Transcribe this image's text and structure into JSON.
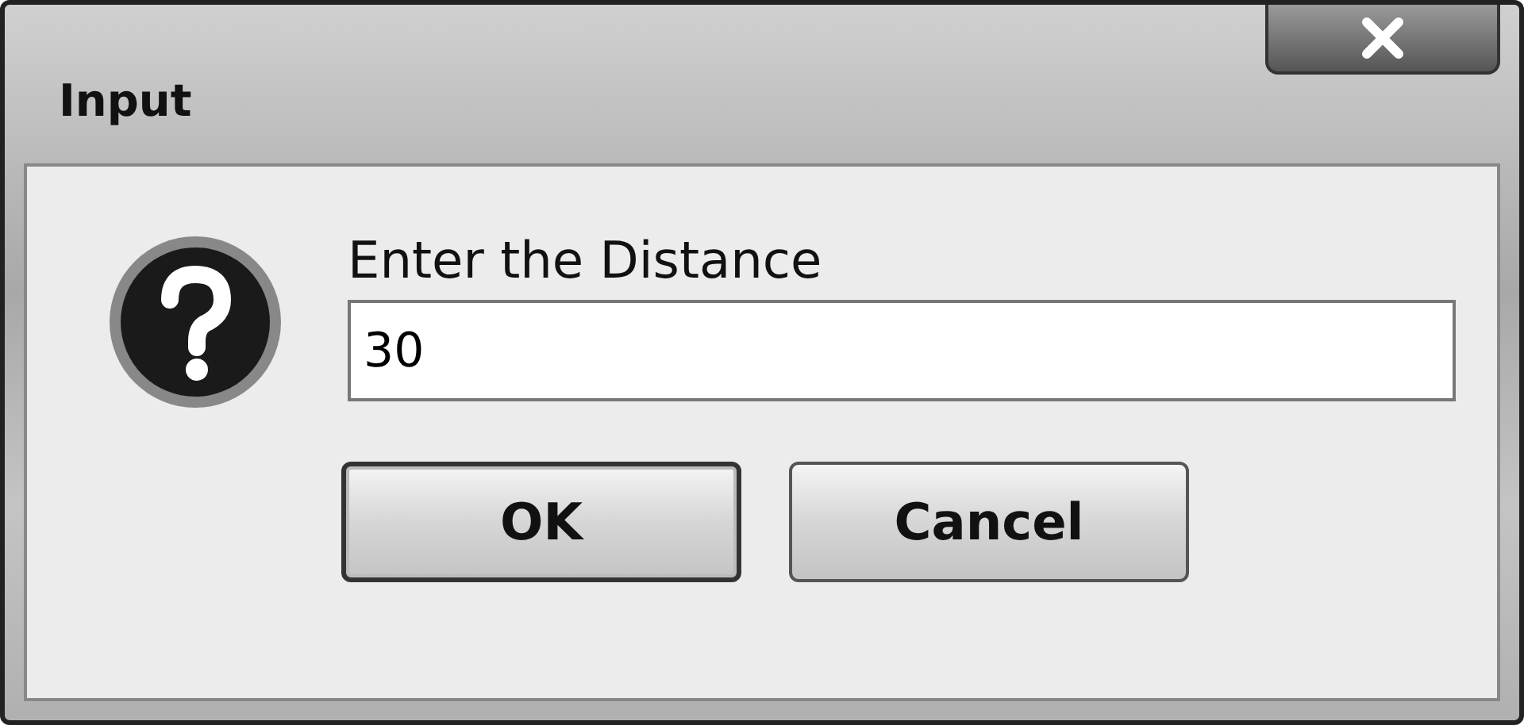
{
  "window": {
    "title": "Input"
  },
  "dialog": {
    "message": "Enter the Distance",
    "value": "30"
  },
  "buttons": [
    {
      "label": "OK",
      "selected": true
    },
    {
      "label": "Cancel",
      "selected": false
    }
  ]
}
